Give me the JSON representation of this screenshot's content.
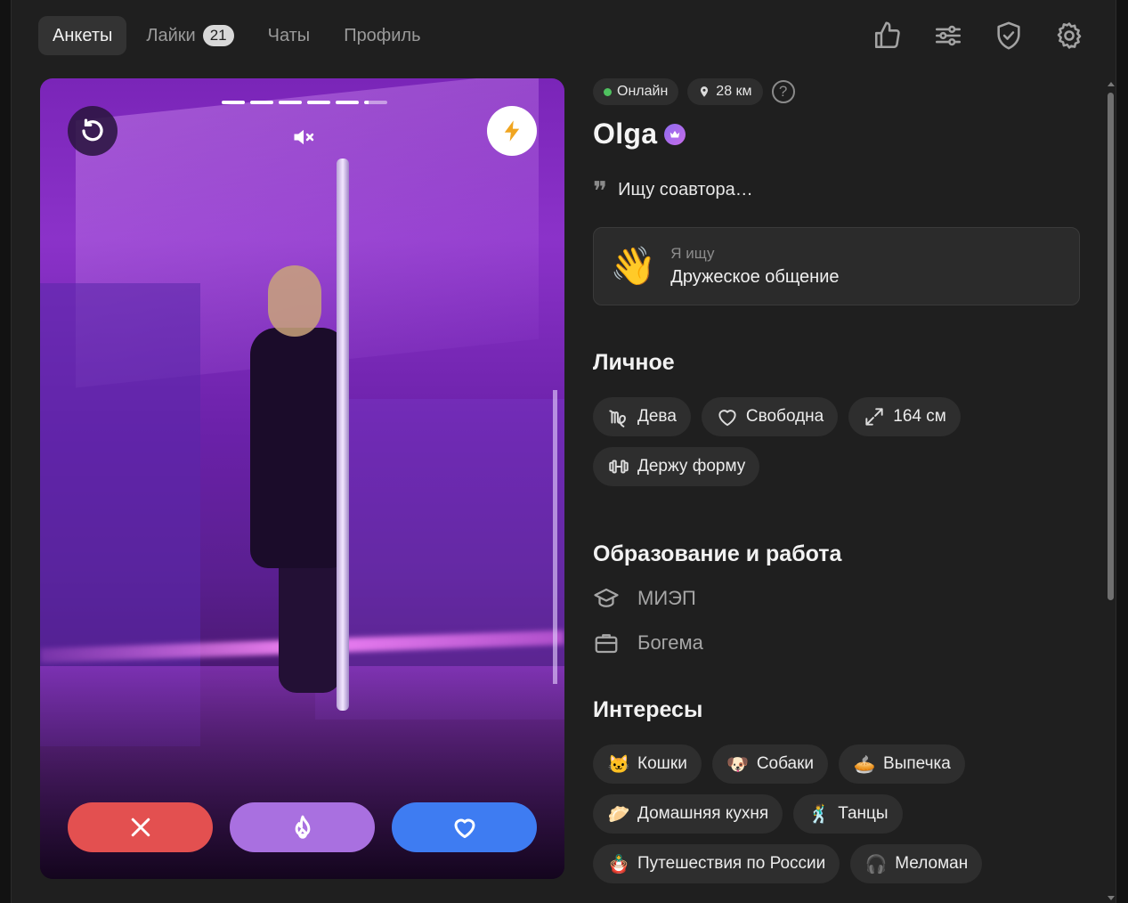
{
  "nav": {
    "tabs": [
      {
        "label": "Анкеты",
        "active": true
      },
      {
        "label": "Лайки",
        "badge": "21"
      },
      {
        "label": "Чаты"
      },
      {
        "label": "Профиль"
      }
    ],
    "icons": [
      "thumbs-up-icon",
      "sliders-icon",
      "shield-check-icon",
      "gear-icon"
    ]
  },
  "media": {
    "progress_segments": 6,
    "current_segment": 6,
    "undo_icon": "undo-icon",
    "mute_icon": "muted-speaker-icon",
    "boost_icon": "lightning-icon",
    "actions": [
      "close-icon",
      "flame-icon",
      "heart-icon"
    ],
    "colors": {
      "dislike": "#e35050",
      "super": "#a970e0",
      "like": "#3e7cf2"
    }
  },
  "profile": {
    "status": "Онлайн",
    "distance": "28 км",
    "help": "?",
    "name": "Olga",
    "quote": "Ищу соавтора…",
    "seeking": {
      "label": "Я ищу",
      "value": "Дружеское общение",
      "emoji": "👋"
    },
    "personal": {
      "title": "Личное",
      "tags": [
        {
          "icon": "virgo-icon",
          "label": "Дева"
        },
        {
          "icon": "heart-outline-icon",
          "label": "Свободна"
        },
        {
          "icon": "expand-icon",
          "label": "164 см"
        },
        {
          "icon": "dumbbell-icon",
          "label": "Держу форму"
        }
      ]
    },
    "education": {
      "title": "Образование и работа",
      "school": "МИЭП",
      "work": "Богема"
    },
    "interests": {
      "title": "Интересы",
      "tags": [
        {
          "emoji": "🐱",
          "label": "Кошки"
        },
        {
          "emoji": "🐶",
          "label": "Собаки"
        },
        {
          "emoji": "🥧",
          "label": "Выпечка"
        },
        {
          "emoji": "🥟",
          "label": "Домашняя кухня"
        },
        {
          "emoji": "🕺",
          "label": "Танцы"
        },
        {
          "emoji": "🪆",
          "label": "Путешествия по России"
        },
        {
          "emoji": "🎧",
          "label": "Меломан"
        }
      ]
    }
  }
}
